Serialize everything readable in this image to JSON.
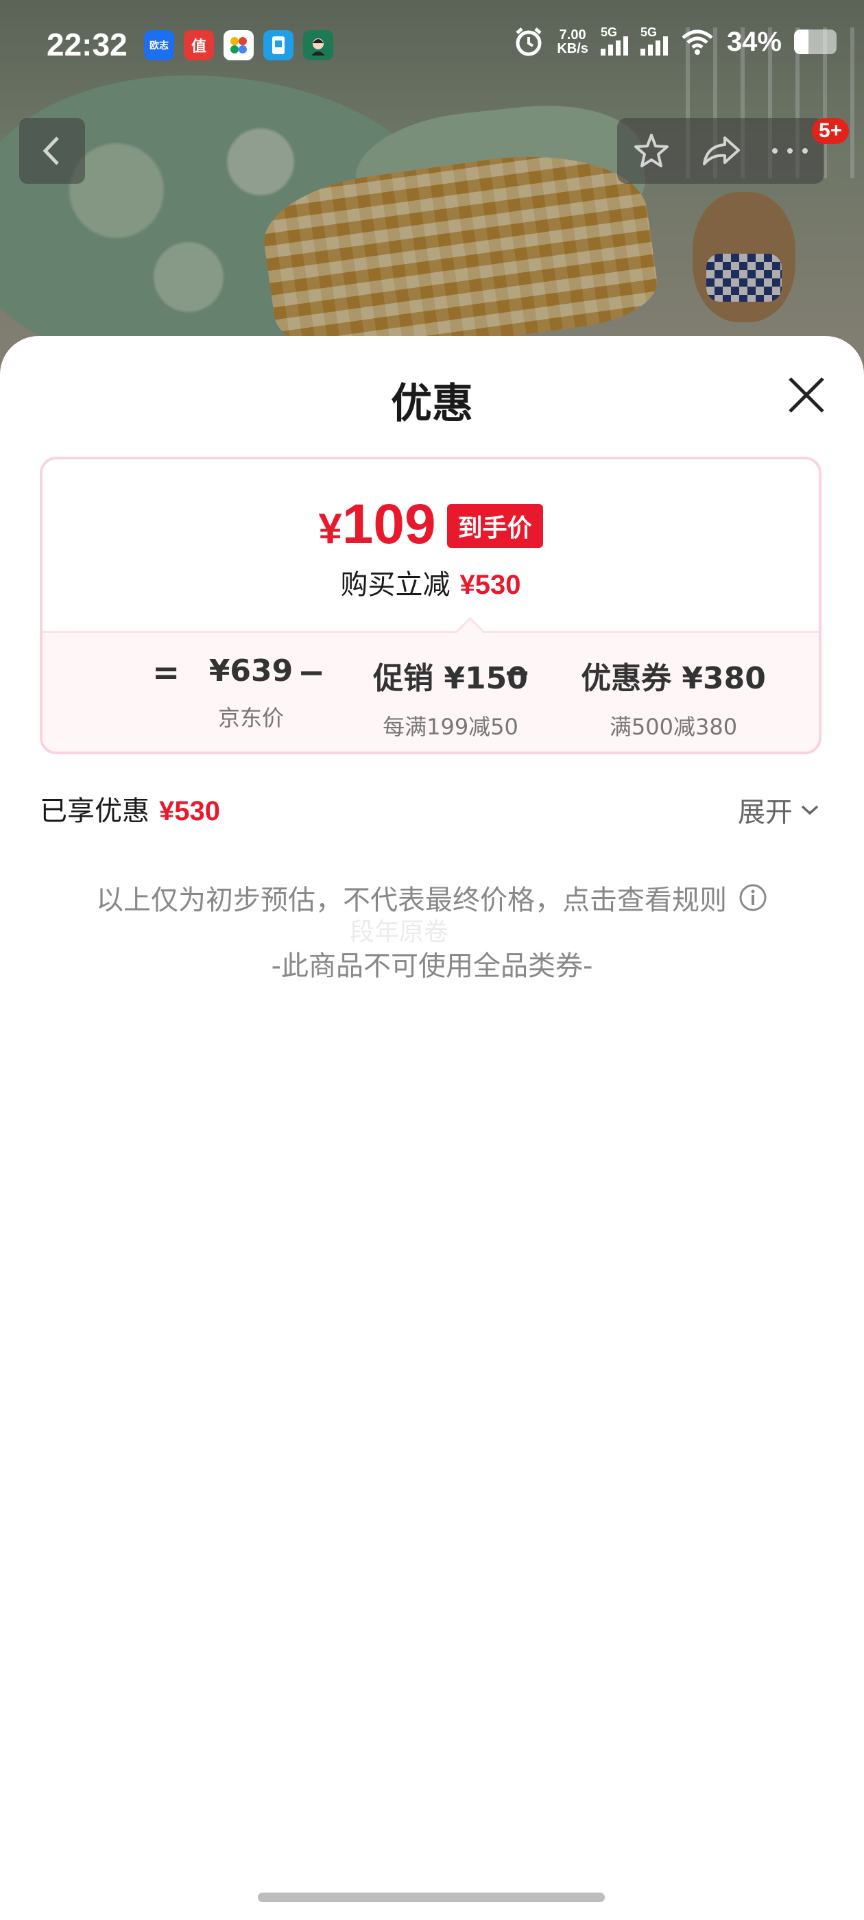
{
  "status_bar": {
    "time": "22:32",
    "net_speed_value": "7.00",
    "net_speed_unit": "KB/s",
    "signal1_label": "5G",
    "signal2_label": "5G",
    "battery_percent": "34%",
    "battery_level": 0.34,
    "app_icons": [
      {
        "name": "ouzhi-app-icon",
        "label": "欧志",
        "color": "#1e6ff0"
      },
      {
        "name": "zhi-app-icon",
        "label": "值",
        "color": "#e53935"
      },
      {
        "name": "colorful-app-icon",
        "label": "",
        "color": "#ffffff"
      },
      {
        "name": "blue-app-icon",
        "label": "",
        "color": "#1fa0e6"
      },
      {
        "name": "avatar-app-icon",
        "label": "",
        "color": "#1e7a55"
      }
    ]
  },
  "nav": {
    "back_icon": "chevron-left-icon",
    "favorite_icon": "star-icon",
    "share_icon": "share-icon",
    "more_icon": "more-icon",
    "badge": "5+"
  },
  "sheet": {
    "title": "优惠",
    "final_price_currency": "¥",
    "final_price_value": "109",
    "final_price_tag": "到手价",
    "reduce_label": "购买立减",
    "reduce_amount": "¥530",
    "formula": {
      "equals": "=",
      "minus": "−",
      "items": [
        {
          "main": "¥639",
          "sub": "京东价"
        },
        {
          "main": "促销 ¥150",
          "sub": "每满199减50"
        },
        {
          "main": "优惠券 ¥380",
          "sub": "满500减380"
        }
      ]
    },
    "enjoyed_label": "已享优惠",
    "enjoyed_amount": "¥530",
    "expand_label": "展开",
    "notice_line1": "以上仅为初步预估，不代表最终价格，点击查看规则",
    "notice_line2": "-此商品不可使用全品类券-",
    "watermark": "段年原卷"
  },
  "colors": {
    "accent_red": "#e8192c",
    "card_border": "#fbd3dc"
  }
}
